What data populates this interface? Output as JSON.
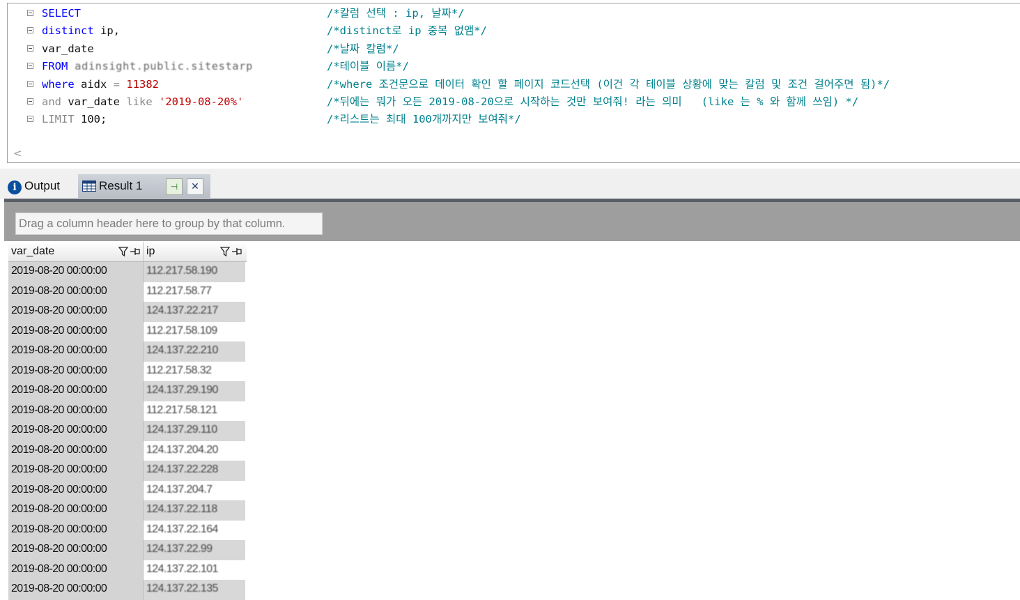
{
  "editor": {
    "lines": [
      {
        "code": [
          {
            "t": "kw",
            "v": "SELECT"
          }
        ],
        "comment": "/*칼럼 선택 : ip, 날짜*/"
      },
      {
        "code": [
          {
            "t": "kw",
            "v": "distinct"
          },
          {
            "t": "tx",
            "v": " ip,"
          }
        ],
        "comment": "/*distinct로 ip 중복 없앰*/"
      },
      {
        "code": [
          {
            "t": "tx",
            "v": "var_date"
          }
        ],
        "comment": "/*날짜 칼럼*/"
      },
      {
        "code": [
          {
            "t": "kw",
            "v": "FROM"
          },
          {
            "t": "blur",
            "v": " adinsight.public.sitestarp"
          }
        ],
        "comment": "/*테이블 이름*/"
      },
      {
        "code": [
          {
            "t": "kw",
            "v": "where"
          },
          {
            "t": "tx",
            "v": " aidx "
          },
          {
            "t": "gr",
            "v": "="
          },
          {
            "t": "num",
            "v": " 11382"
          }
        ],
        "comment": "/*where 조건문으로 데이터 확인 할 페이지 코드선택 (이건 각 테이블 상황에 맞는 칼럼 및 조건 걸어주면 됨)*/"
      },
      {
        "code": [
          {
            "t": "gr",
            "v": "and"
          },
          {
            "t": "tx",
            "v": " var_date "
          },
          {
            "t": "gr",
            "v": "like"
          },
          {
            "t": "str",
            "v": " '2019-08-20%'"
          }
        ],
        "comment": "/*뒤에는 뭐가 오든 2019-08-20으로 시작하는 것만 보여줘! 라는 의미   (like 는 % 와 함께 쓰임) */"
      },
      {
        "code": [
          {
            "t": "gr",
            "v": "LIMIT"
          },
          {
            "t": "tx",
            "v": " 100;"
          }
        ],
        "comment": "/*리스트는 최대 100개까지만 보여줘*/"
      }
    ],
    "scroll_arrow": "<"
  },
  "tabs": {
    "output_label": "Output",
    "result_label": "Result 1",
    "pin_glyph": "⊣",
    "close_glyph": "✕"
  },
  "group_panel": {
    "hint": "Drag a column header here to group by that column."
  },
  "grid": {
    "columns": [
      "var_date",
      "ip"
    ],
    "rows": [
      {
        "var_date": "2019-08-20 00:00:00",
        "ip": "112.217.58.190"
      },
      {
        "var_date": "2019-08-20 00:00:00",
        "ip": "112.217.58.77"
      },
      {
        "var_date": "2019-08-20 00:00:00",
        "ip": "124.137.22.217"
      },
      {
        "var_date": "2019-08-20 00:00:00",
        "ip": "112.217.58.109"
      },
      {
        "var_date": "2019-08-20 00:00:00",
        "ip": "124.137.22.210"
      },
      {
        "var_date": "2019-08-20 00:00:00",
        "ip": "112.217.58.32"
      },
      {
        "var_date": "2019-08-20 00:00:00",
        "ip": "124.137.29.190"
      },
      {
        "var_date": "2019-08-20 00:00:00",
        "ip": "112.217.58.121"
      },
      {
        "var_date": "2019-08-20 00:00:00",
        "ip": "124.137.29.110"
      },
      {
        "var_date": "2019-08-20 00:00:00",
        "ip": "124.137.204.20"
      },
      {
        "var_date": "2019-08-20 00:00:00",
        "ip": "124.137.22.228"
      },
      {
        "var_date": "2019-08-20 00:00:00",
        "ip": "124.137.204.7"
      },
      {
        "var_date": "2019-08-20 00:00:00",
        "ip": "124.137.22.118"
      },
      {
        "var_date": "2019-08-20 00:00:00",
        "ip": "124.137.22.164"
      },
      {
        "var_date": "2019-08-20 00:00:00",
        "ip": "124.137.22.99"
      },
      {
        "var_date": "2019-08-20 00:00:00",
        "ip": "124.137.22.101"
      },
      {
        "var_date": "2019-08-20 00:00:00",
        "ip": "124.137.22.135"
      }
    ]
  },
  "colors": {
    "keyword": "#0000ff",
    "comment": "#00808c",
    "number": "#b80000",
    "string": "#c00000",
    "result_tab": "#b9bec7",
    "group_panel": "#9e9e9e"
  }
}
